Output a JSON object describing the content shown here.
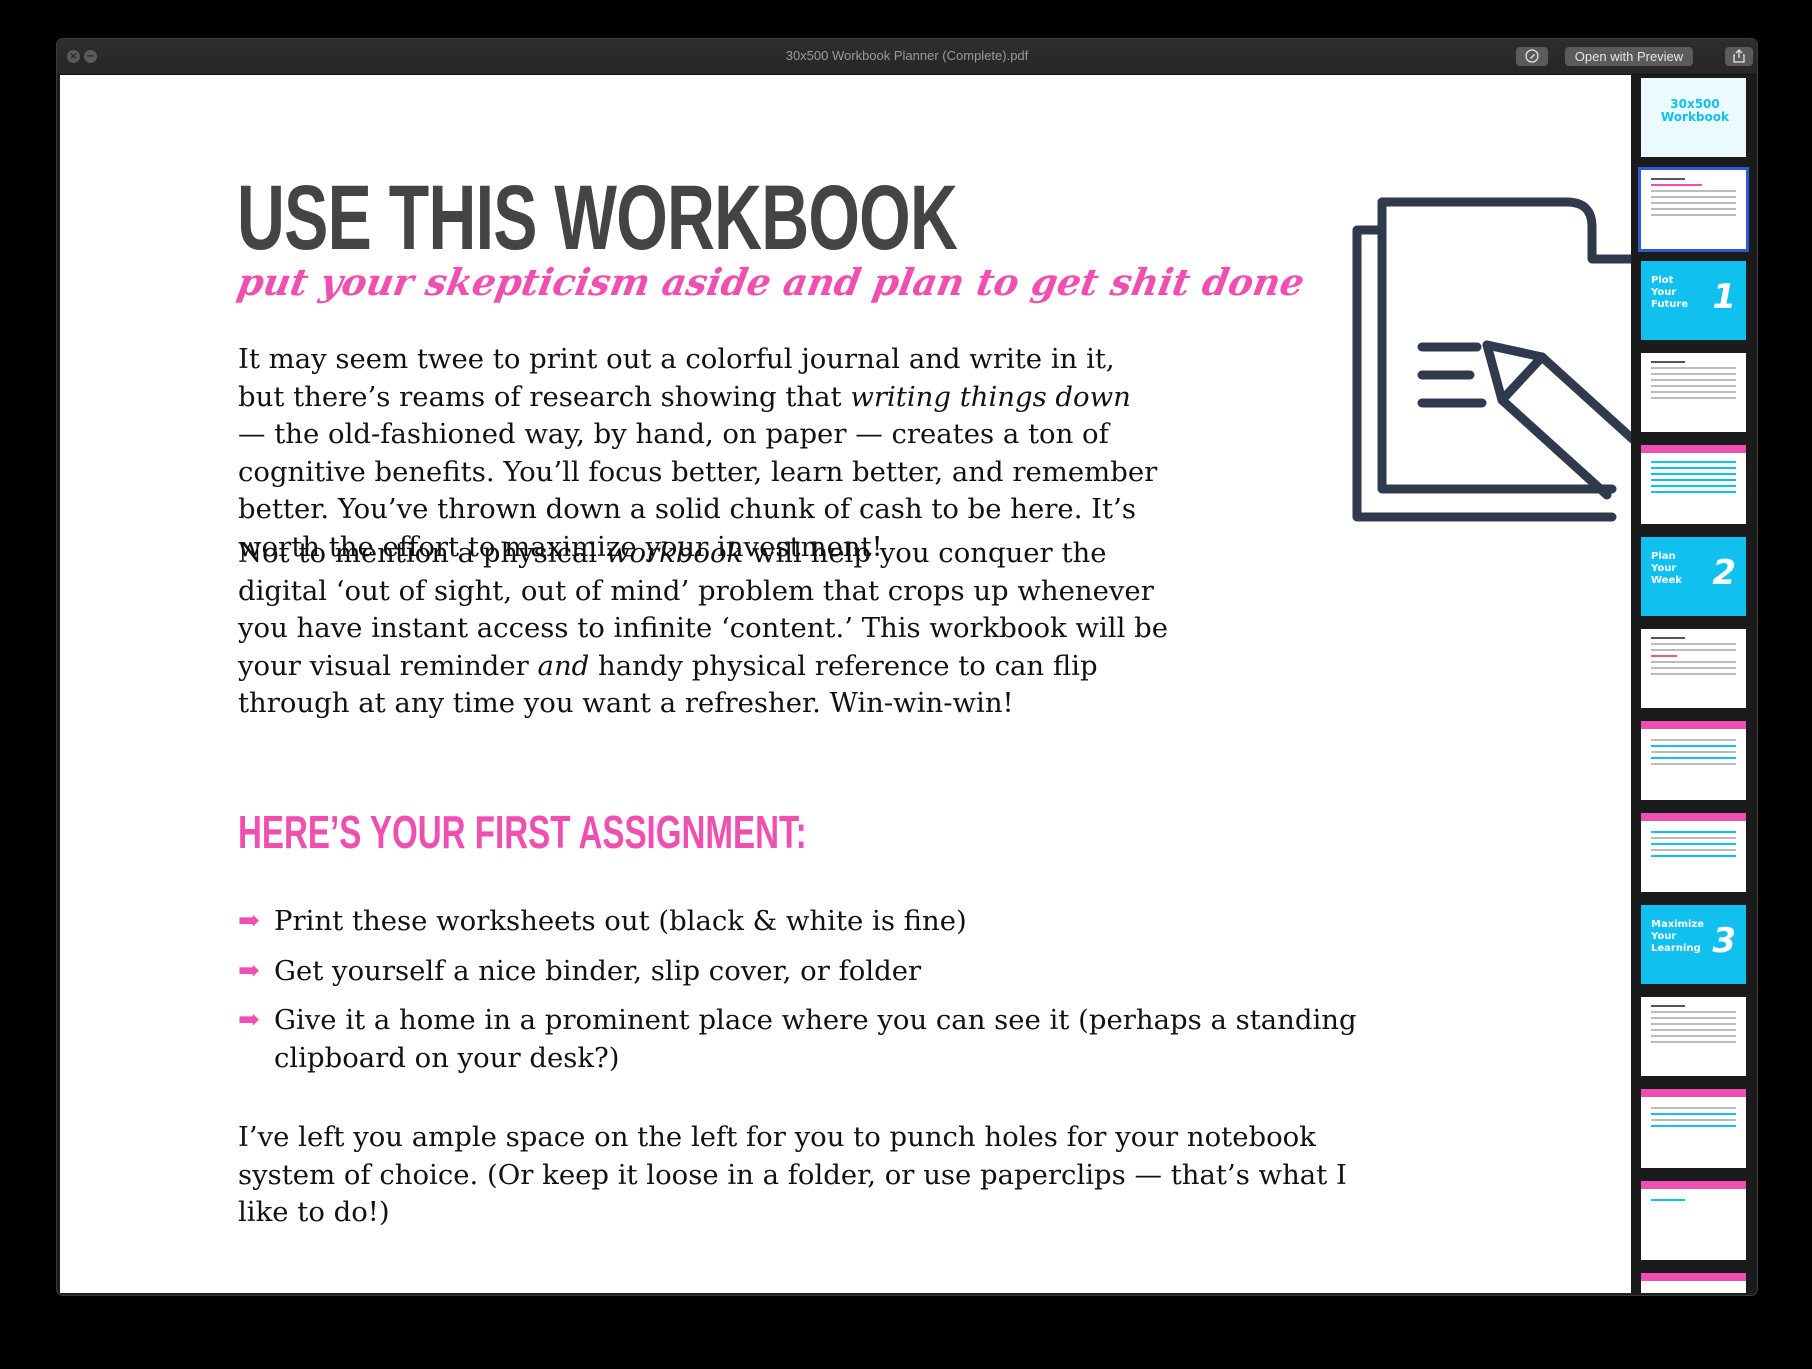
{
  "window": {
    "title": "30x500 Workbook Planner (Complete).pdf",
    "open_with_preview_label": "Open with Preview",
    "close_glyph": "×",
    "minimize_glyph": "−"
  },
  "page": {
    "heading": "USE THIS WORKBOOK",
    "tagline": "put your skepticism aside and plan to get shit done",
    "para1": {
      "a": "It may seem twee to print out a colorful journal and write in it, but there’s reams of research showing that ",
      "em": "writing things down",
      "b": " — the old-fashioned way, by hand, on paper — creates a ton of cognitive benefits. You’ll focus better, learn better, and remember better. You’ve thrown down a solid chunk of cash to be here. It’s worth the effort to maximize your investment!"
    },
    "para2": {
      "a": "Not to mention a physical ",
      "em1": "workbook",
      "b": " will help you conquer the digital ‘out of sight, out of mind’ problem that crops up whenever you have instant access to infinite ‘content.’ This workbook will be your visual reminder ",
      "em2": "and",
      "c": " handy physical reference to can flip through at any time you want a refresher.  Win-win-win!"
    },
    "subheading": "HERE’S YOUR FIRST ASSIGNMENT:",
    "bullets": [
      "Print these worksheets out (black & white is fine)",
      "Get yourself a nice binder, slip cover, or folder",
      "Give it a home in a prominent place where you can see it (perhaps a standing clipboard on your desk?)"
    ],
    "bullet_glyph": "➡",
    "para3": "I’ve left you ample space on the left for you to punch holes for your notebook system of choice. (Or keep it loose in a folder, or use paperclips — that’s what I like to do!)"
  },
  "sidebar": {
    "thumbs": [
      {
        "kind": "cover",
        "title": "30x500 Workbook"
      },
      {
        "kind": "text",
        "selected": true
      },
      {
        "kind": "section",
        "title": "Plot Your Future",
        "num": "1"
      },
      {
        "kind": "text"
      },
      {
        "kind": "form"
      },
      {
        "kind": "section",
        "title": "Plan Your Week",
        "num": "2"
      },
      {
        "kind": "text"
      },
      {
        "kind": "form"
      },
      {
        "kind": "form"
      },
      {
        "kind": "section",
        "title": "Maximize Your Learning",
        "num": "3"
      },
      {
        "kind": "text"
      },
      {
        "kind": "form"
      },
      {
        "kind": "form"
      },
      {
        "kind": "form"
      }
    ]
  },
  "colors": {
    "accent_pink": "#ee4fb0",
    "section_blue": "#10c1ef",
    "icon_navy": "#2f3a4d",
    "selection_blue": "#2b5bd7"
  }
}
